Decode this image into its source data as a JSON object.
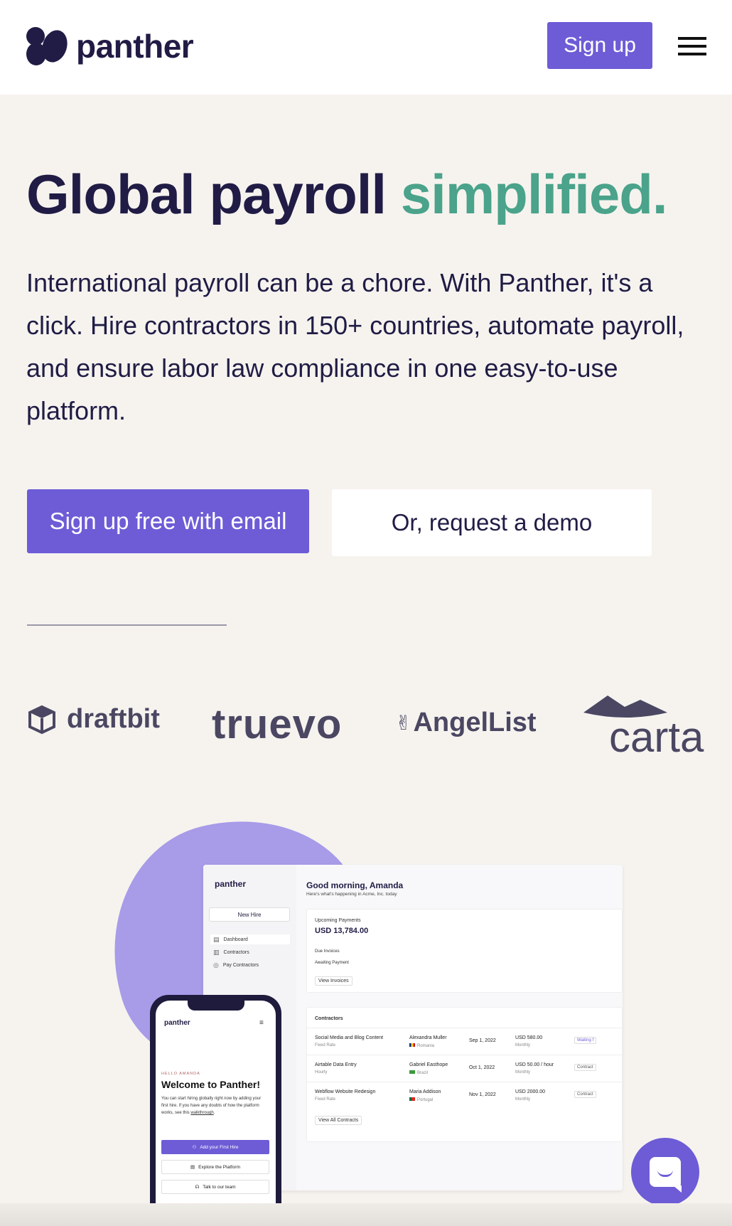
{
  "header": {
    "logo_text": "panther",
    "signup_label": "Sign up"
  },
  "hero": {
    "title_main": "Global payroll ",
    "title_accent": "simplified.",
    "description": "International payroll can be a chore. With Panther, it's a click. Hire contractors in 150+ countries, automate payroll, and ensure labor law compliance in one easy-to-use platform.",
    "cta_primary": "Sign up free with email",
    "cta_secondary": "Or, request a demo"
  },
  "brands": {
    "draftbit": "draftbit",
    "truevo": "truevo",
    "angellist": "AngelList",
    "angellist_glyph": "✌",
    "carta": "carta"
  },
  "dashboard": {
    "logo_text": "panther",
    "new_hire": "New Hire",
    "nav": [
      "Dashboard",
      "Contractors",
      "Pay Contractors"
    ],
    "greeting": "Good morning, Amanda",
    "subtitle": "Here's what's happening in Acme, Inc. today",
    "upcoming_label": "Upcoming Payments",
    "upcoming_amount": "USD 13,784.00",
    "due_invoices": "Due Invoices",
    "awaiting_payment": "Awaiting Payment",
    "view_invoices": "View Invoices",
    "contractors_title": "Contractors",
    "rows": [
      {
        "title": "Social Media and Blog Content",
        "rate_type": "Fixed Rate",
        "name": "Alexandra Muller",
        "country": "Romania",
        "date": "Sep 1, 2022",
        "amount": "USD 580.00",
        "period": "Monthly",
        "status": "Waiting f"
      },
      {
        "title": "Airtable Data Entry",
        "rate_type": "Hourly",
        "name": "Gabriel Easthope",
        "country": "Brazil",
        "date": "Oct 1, 2022",
        "amount": "USD 50.00 / hour",
        "period": "Monthly",
        "status": "Contract"
      },
      {
        "title": "Webflow Website Redesign",
        "rate_type": "Fixed Rate",
        "name": "Maria Addison",
        "country": "Portugal",
        "date": "Nov 1, 2022",
        "amount": "USD 2000.00",
        "period": "Monthly",
        "status": "Contract"
      }
    ],
    "view_all": "View All Contracts"
  },
  "phone": {
    "logo_text": "panther",
    "hello": "HELLO AMANDA",
    "title": "Welcome to Panther!",
    "body": "You can start hiring globally right now by adding your first hire. If you have any doubts of how the platform works, see this ",
    "body_link": "walkthrough",
    "body_end": ".",
    "btn_add": "Add your First Hire",
    "btn_explore": "Explore the Platform",
    "btn_talk": "Talk to our team"
  },
  "colors": {
    "brand_purple": "#6d5cd6",
    "accent_green": "#4aa38a",
    "navy": "#201c45",
    "background": "#f6f3ef"
  }
}
